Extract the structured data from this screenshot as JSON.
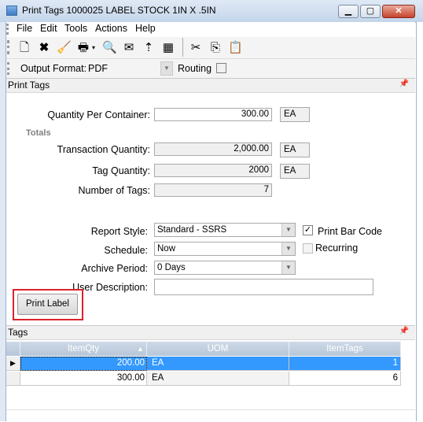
{
  "window": {
    "title": "Print Tags 1000025 LABEL STOCK 1IN X .5IN"
  },
  "menu": [
    "File",
    "Edit",
    "Tools",
    "Actions",
    "Help"
  ],
  "format_bar": {
    "output_label": "Output Format:",
    "output_value": "PDF",
    "routing_label": "Routing",
    "routing_checked": false
  },
  "print_tags": {
    "section_label": "Print Tags",
    "qty_per_container": {
      "label": "Quantity Per Container:",
      "value": "300.00",
      "uom": "EA"
    },
    "totals_label": "Totals",
    "transaction_qty": {
      "label": "Transaction Quantity:",
      "value": "2,000.00",
      "uom": "EA"
    },
    "tag_qty": {
      "label": "Tag Quantity:",
      "value": "2000",
      "uom": "EA"
    },
    "num_tags": {
      "label": "Number of Tags:",
      "value": "7"
    },
    "report_style": {
      "label": "Report Style:",
      "value": "Standard - SSRS"
    },
    "print_bar_code": {
      "label": "Print Bar Code",
      "checked": true
    },
    "schedule": {
      "label": "Schedule:",
      "value": "Now"
    },
    "recurring": {
      "label": "Recurring",
      "checked": false
    },
    "archive_period": {
      "label": "Archive Period:",
      "value": "0 Days"
    },
    "user_description": {
      "label": "User Description:",
      "value": ""
    },
    "print_label_button": "Print Label"
  },
  "tags": {
    "section_label": "Tags",
    "columns": [
      "ItemQty",
      "UOM",
      "ItemTags"
    ],
    "rows": [
      {
        "item_qty": "200.00",
        "uom": "EA",
        "item_tags": "1"
      },
      {
        "item_qty": "300.00",
        "uom": "EA",
        "item_tags": "6"
      }
    ]
  },
  "colors": {
    "selection": "#3399ff",
    "highlight_border": "#d9232d"
  }
}
